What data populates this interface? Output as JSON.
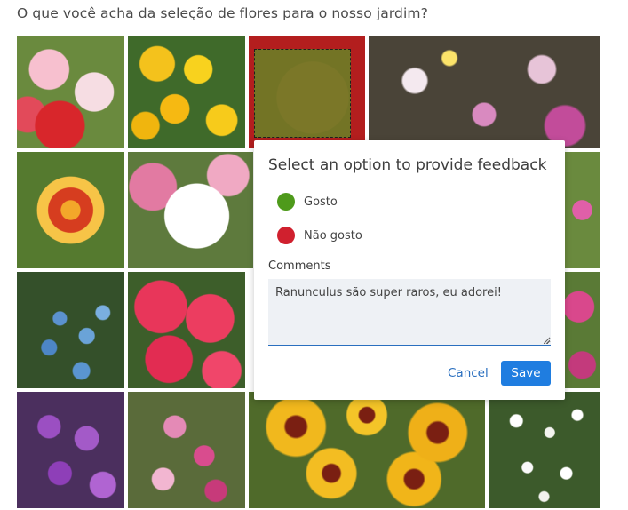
{
  "question": "O que você acha da seleção de flores para o nosso jardim?",
  "feedback_popup": {
    "title": "Select an option to provide feedback",
    "options": [
      {
        "label": "Gosto",
        "color": "#4e9a1b"
      },
      {
        "label": "Não gosto",
        "color": "#d0202e"
      }
    ],
    "comments_label": "Comments",
    "comments_value": "Ranunculus são super raros, eu adorei!",
    "cancel_label": "Cancel",
    "save_label": "Save"
  },
  "colors": {
    "accent": "#1f7de0",
    "selection_overlay": "#5a9628"
  }
}
